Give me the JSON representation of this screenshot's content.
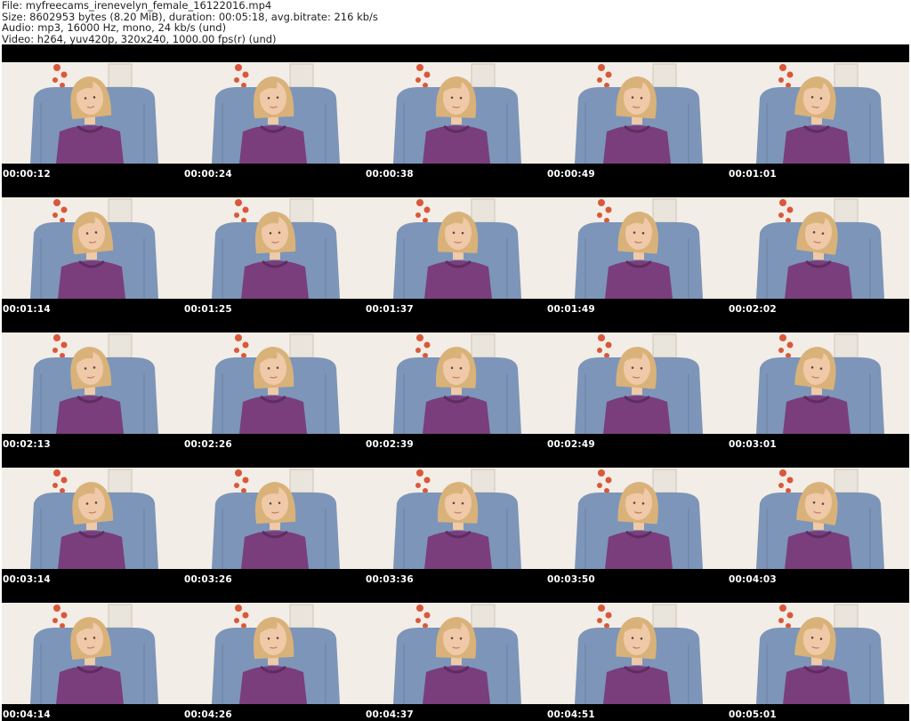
{
  "header": {
    "file": "File: myfreecams_irenevelyn_female_16122016.mp4",
    "size": "Size: 8602953 bytes (8.20 MiB), duration: 00:05:18, avg.bitrate: 216 kb/s",
    "audio": "Audio: mp3, 16000 Hz, mono, 24 kb/s (und)",
    "video": "Video: h264, yuv420p, 320x240, 1000.00 fps(r) (und)"
  },
  "thumbnails": [
    {
      "timestamp": "00:00:12"
    },
    {
      "timestamp": "00:00:24"
    },
    {
      "timestamp": "00:00:38"
    },
    {
      "timestamp": "00:00:49"
    },
    {
      "timestamp": "00:01:01"
    },
    {
      "timestamp": "00:01:14"
    },
    {
      "timestamp": "00:01:25"
    },
    {
      "timestamp": "00:01:37"
    },
    {
      "timestamp": "00:01:49"
    },
    {
      "timestamp": "00:02:02"
    },
    {
      "timestamp": "00:02:13"
    },
    {
      "timestamp": "00:02:26"
    },
    {
      "timestamp": "00:02:39"
    },
    {
      "timestamp": "00:02:49"
    },
    {
      "timestamp": "00:03:01"
    },
    {
      "timestamp": "00:03:14"
    },
    {
      "timestamp": "00:03:26"
    },
    {
      "timestamp": "00:03:36"
    },
    {
      "timestamp": "00:03:50"
    },
    {
      "timestamp": "00:04:03"
    },
    {
      "timestamp": "00:04:14"
    },
    {
      "timestamp": "00:04:26"
    },
    {
      "timestamp": "00:04:37"
    },
    {
      "timestamp": "00:04:51"
    },
    {
      "timestamp": "00:05:01"
    }
  ],
  "colors": {
    "sheet_background": "#000000",
    "timestamp_text": "#ffffff",
    "wall": "#f2ede6",
    "armchair": "#7d95b8",
    "top": "#7a3e7c",
    "hair": "#d9b27a",
    "skin": "#efc9a8",
    "flowers": "#d9583a"
  }
}
